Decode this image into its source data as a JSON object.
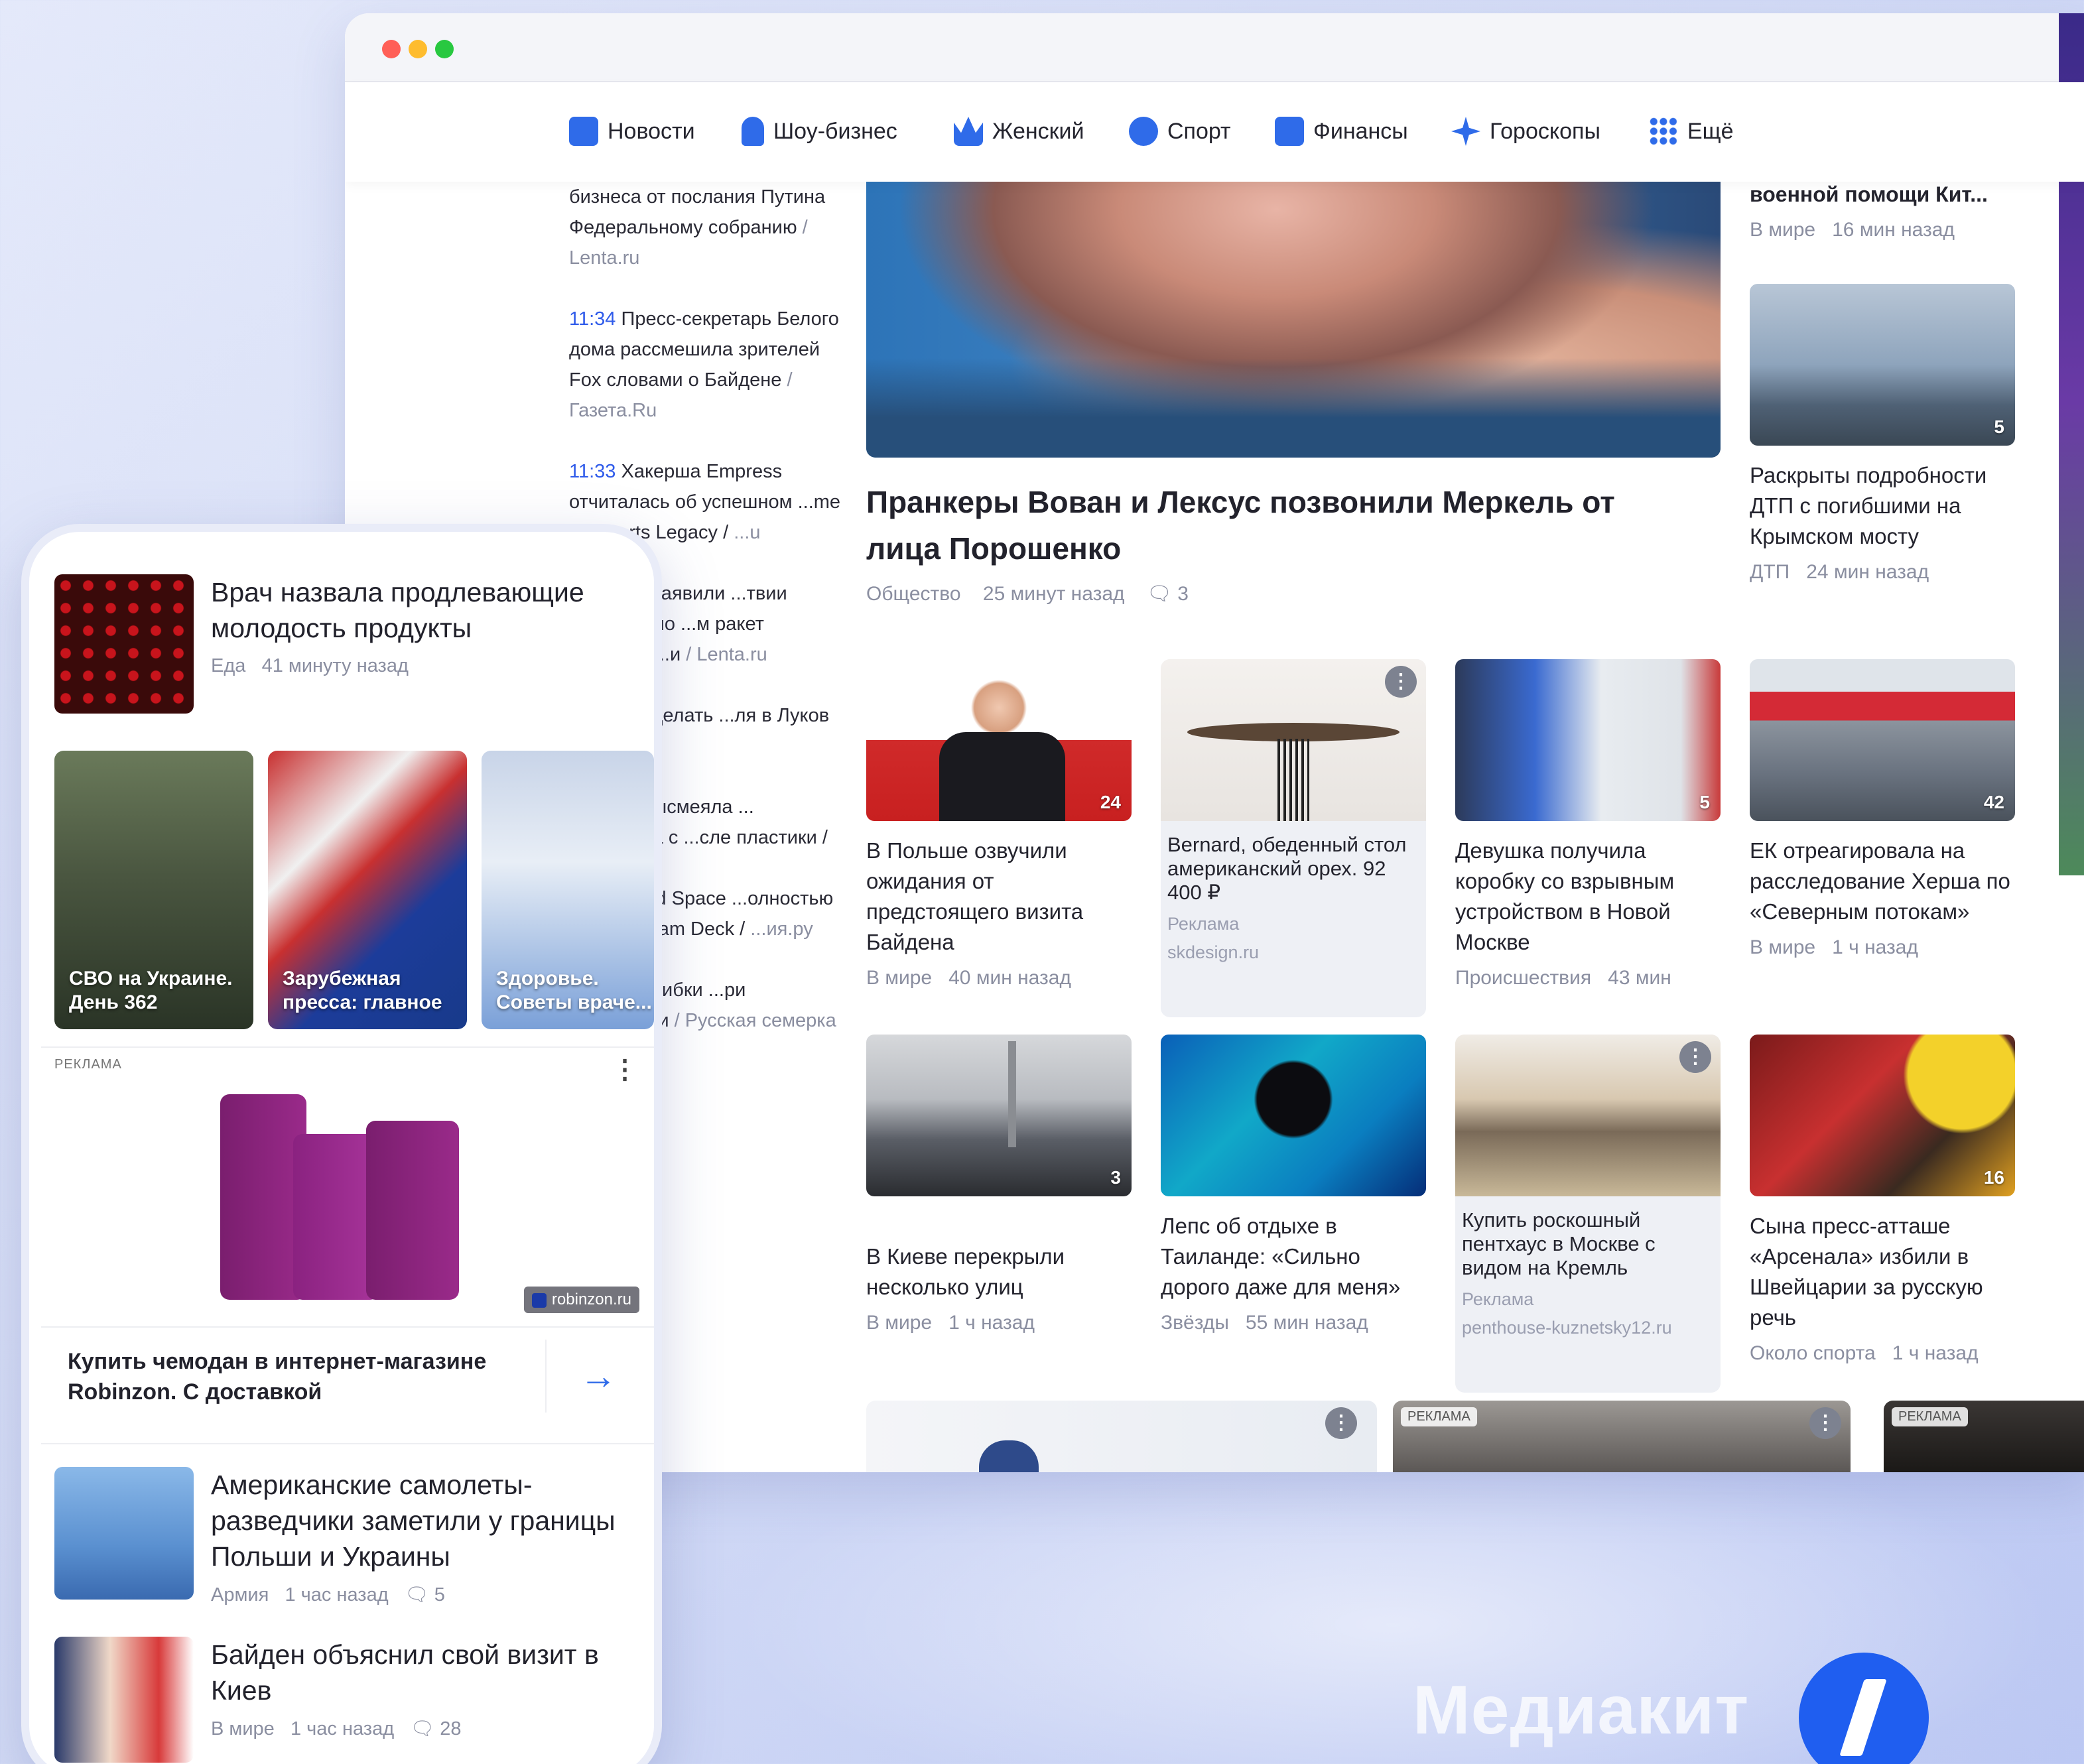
{
  "browser": {
    "nav": [
      {
        "label": "Новости",
        "icon": "news-icon",
        "color": "#2f6be9"
      },
      {
        "label": "Шоу-бизнес",
        "icon": "microphone-icon",
        "color": "#2f6be9"
      },
      {
        "label": "Женский",
        "icon": "crown-icon",
        "color": "#2f6be9"
      },
      {
        "label": "Спорт",
        "icon": "ball-icon",
        "color": "#2f6be9"
      },
      {
        "label": "Финансы",
        "icon": "wallet-icon",
        "color": "#2f6be9"
      },
      {
        "label": "Гороскопы",
        "icon": "star-icon",
        "color": "#2f6be9"
      },
      {
        "label": "Ещё",
        "icon": "grid-icon",
        "color": "#2f6be9"
      }
    ],
    "feed": [
      {
        "time": "",
        "text": "бизнеса от послания Путина Федеральному собранию",
        "source": " / Lenta.ru"
      },
      {
        "time": "11:34",
        "text": " Пресс-секретарь Белого дома рассмешила зрителей Fox словами о Байдене",
        "source": " / Газета.Ru"
      },
      {
        "time": "11:33",
        "text": " Хакерша Empress отчиталась об успешном ...me Hogwarts Legacy /",
        "source": " ...u"
      },
      {
        "time": "",
        "text": "...краине заявили ...твии решений по ...м ракет большой ...и",
        "source": " / Lenta.ru"
      },
      {
        "time": "",
        "text": "...нельзя делать ...ля в Луков день /",
        "source": ""
      },
      {
        "time": "",
        "text": "...внова высмеяла ... Киркорова с ...сле пластики /",
        "source": ""
      },
      {
        "time": "",
        "text": "...ейк Dead Space ...олностью ...м со Steam Deck /",
        "source": " ...ия.ру"
      },
      {
        "time": "",
        "text": "...вные ошибки ...ри посещении",
        "source": " / Русская семерка"
      }
    ],
    "hero": {
      "title": "Пранкеры Вован и Лексус позвонили Меркель от лица Порошенко",
      "category": "Общество",
      "time": "25 минут назад",
      "comments": "3"
    },
    "side": [
      {
        "title": "военной помощи Кит...",
        "category": "В мире",
        "time": "16 мин назад"
      },
      {
        "title": "Раскрыты подробности ДТП с погибшими на Крымском мосту",
        "category": "ДТП",
        "time": "24 мин назад",
        "comments": "5"
      }
    ],
    "row1": [
      {
        "title": "В Польше озвучили ожидания от предстоящего визита Байдена",
        "category": "В мире",
        "time": "40 мин назад",
        "comments": "24"
      },
      {
        "ad": true,
        "title": "Bernard, обеденный стол американский орех. 92 400 ₽",
        "label": "Реклама",
        "domain": "skdesign.ru"
      },
      {
        "title": "Девушка получила коробку со взрывным устройством в Новой Москве",
        "category": "Происшествия",
        "time": "43 мин",
        "comments": "5"
      },
      {
        "title": "ЕК отреагировала на расследование Херша по «Северным потокам»",
        "category": "В мире",
        "time": "1 ч назад",
        "comments": "42"
      }
    ],
    "row2": [
      {
        "title": "В Киеве перекрыли несколько улиц",
        "category": "В мире",
        "time": "1 ч назад",
        "comments": "3"
      },
      {
        "title": "Лепс об отдыхе в Таиланде: «Сильно дорого даже для меня»",
        "category": "Звёзды",
        "time": "55 мин назад"
      },
      {
        "ad": true,
        "title": "Купить роскошный пентхаус в Москве с видом на Кремль",
        "label": "Реклама",
        "domain": "penthouse-kuznetsky12.ru"
      },
      {
        "title": "Сына пресс-атташе «Арсенала» избили в Швейцарии за русскую речь",
        "category": "Около спорта",
        "time": "1 ч назад",
        "comments": "16"
      }
    ],
    "bottom_badge": "РЕКЛАМА"
  },
  "phone": {
    "top": {
      "title": "Врач назвала продлевающие молодость продукты",
      "category": "Еда",
      "time": "41 минуту назад"
    },
    "stories": [
      {
        "label": "СВО на Украине. День 362"
      },
      {
        "label": "Зарубежная пресса: главное"
      },
      {
        "label": "Здоровье. Советы враче..."
      }
    ],
    "ad": {
      "badge": "РЕКЛАМА",
      "domain": "robinzon.ru",
      "title": "Купить чемодан в интернет-магазине Robinzon. С доставкой"
    },
    "news": [
      {
        "title": "Американские самолеты-разведчики заметили у границы Польши и Украины",
        "category": "Армия",
        "time": "1 час назад",
        "comments": "5"
      },
      {
        "title": "Байден объяснил свой визит в Киев",
        "category": "В мире",
        "time": "1 час назад",
        "comments": "28"
      }
    ]
  },
  "brand": {
    "label": "Медиакит"
  }
}
